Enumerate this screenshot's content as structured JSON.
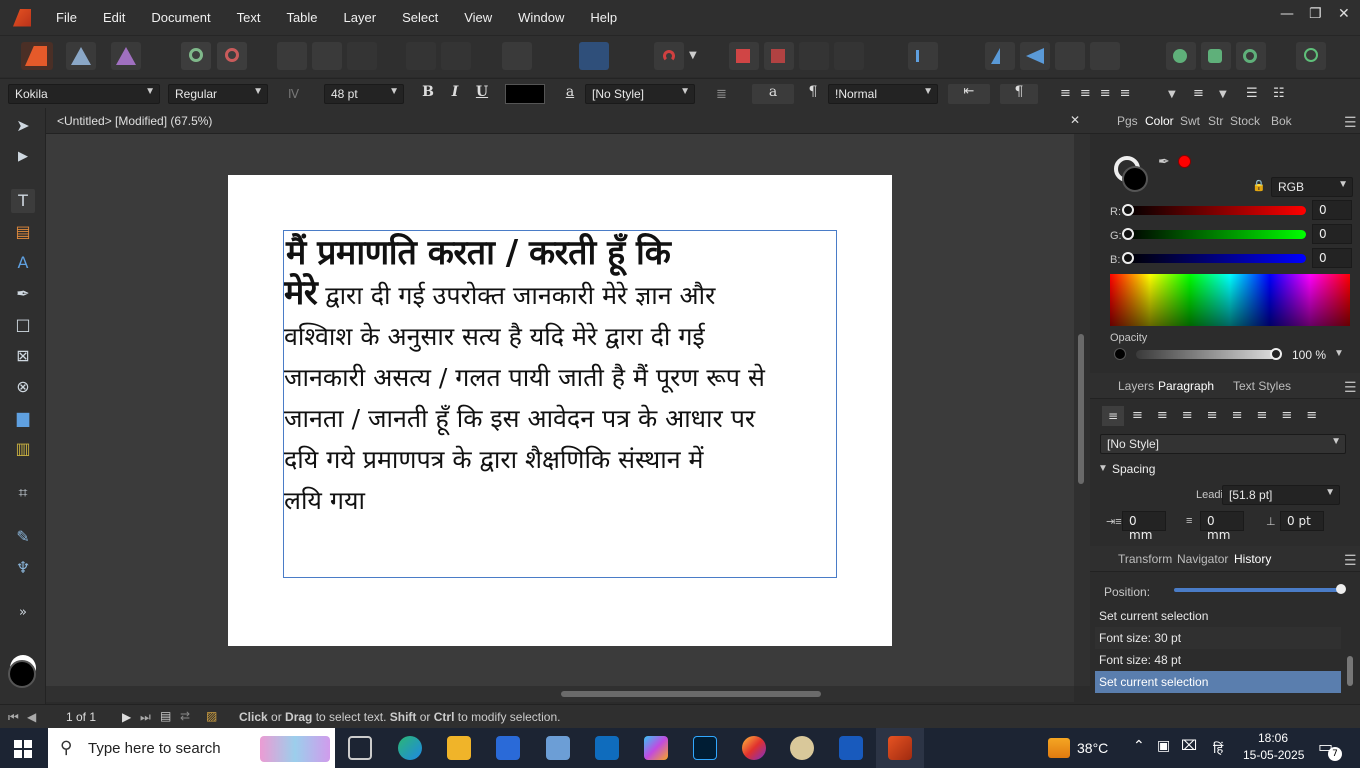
{
  "menu": [
    "File",
    "Edit",
    "Document",
    "Text",
    "Table",
    "Layer",
    "Select",
    "View",
    "Window",
    "Help"
  ],
  "context": {
    "font": "Kokila",
    "style": "Regular",
    "size": "48 pt",
    "char_style": "[No Style]",
    "para_style": "!Normal",
    "bold": "B",
    "italic": "I",
    "underline": "U",
    "char_a": "a",
    "char_a2": "a",
    "pilcrow": "¶"
  },
  "document": {
    "title": "<Untitled> [Modified] (67.5%)",
    "line1": "मैं प्रमाणति करता / करती हूँ कि",
    "line2_bold": "मेरे",
    "line2_rest": "  द्वारा दी गई उपरोक्त जानकारी मेरे ज्ञान और",
    "line3": "वश्विाश के अनुसार सत्य है यदि मेरे द्वारा दी गई",
    "line4": "जानकारी असत्य / गलत पायी जाती है मैं पूरण रूप से",
    "line5": "जानता / जानती हूँ कि इस आवेदन पत्र के आधार पर",
    "line6": "दयि गये प्रमाणपत्र के द्वारा शैक्षणिकि संस्थान में",
    "line7": "लयि गया"
  },
  "color_panel": {
    "tabs": [
      "Pgs",
      "Color",
      "Swt",
      "Str",
      "Stock",
      "Bok"
    ],
    "active_tab": "Color",
    "model": "RGB",
    "r_label": "R:",
    "g_label": "G:",
    "b_label": "B:",
    "r": "0",
    "g": "0",
    "b": "0",
    "opacity_label": "Opacity",
    "opacity": "100 %",
    "accent": "#ff0000"
  },
  "paragraph_panel": {
    "tabs": [
      "Layers",
      "Paragraph",
      "Text Styles"
    ],
    "active_tab": "Paragraph",
    "style": "[No Style]",
    "spacing_label": "Spacing",
    "leading_label": "Leading:",
    "leading": "[51.8 pt]",
    "indent_left": "0 mm",
    "indent_right": "0 mm",
    "space_before": "0 pt"
  },
  "history_panel": {
    "tabs": [
      "Transform",
      "Navigator",
      "History"
    ],
    "active_tab": "History",
    "position_label": "Position:",
    "items": [
      "Set current selection",
      "Font size: 30 pt",
      "Font size: 48 pt",
      "Set current selection"
    ],
    "selected_index": 3
  },
  "status": {
    "page": "1 of 1",
    "hint_click": "Click",
    "hint_or1": " or ",
    "hint_drag": "Drag",
    "hint_mid": " to select text. ",
    "hint_shift": "Shift",
    "hint_or2": " or ",
    "hint_ctrl": "Ctrl",
    "hint_end": " to modify selection."
  },
  "taskbar": {
    "search_placeholder": "Type here to search",
    "weather": "38°C",
    "lang": "हिं",
    "time": "18:06",
    "date": "15-05-2025",
    "notif_count": "7"
  }
}
